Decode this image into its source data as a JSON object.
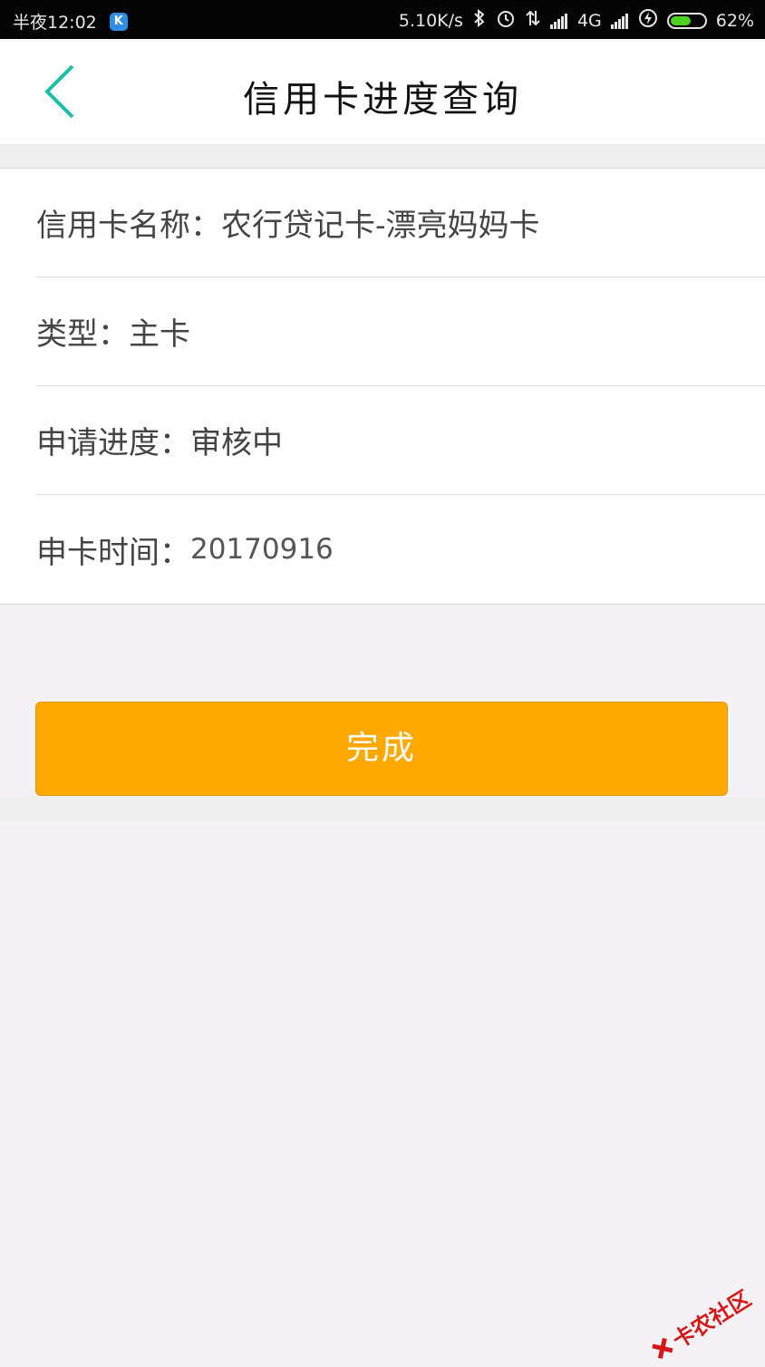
{
  "status_bar": {
    "time": "半夜12:02",
    "app_badge": "K",
    "net_speed": "5.10K/s",
    "network": "4G",
    "battery_level": 0.62,
    "battery_text": "62%"
  },
  "header": {
    "title": "信用卡进度查询"
  },
  "details": {
    "card_name_label": "信用卡名称：",
    "card_name_value": "农行贷记卡-漂亮妈妈卡",
    "type_label": "类型：",
    "type_value": "主卡",
    "progress_label": "申请进度：",
    "progress_value": "审核中",
    "apply_time_label": "申卡时间：",
    "apply_time_value": "20170916"
  },
  "actions": {
    "done_label": "完成"
  },
  "watermark": {
    "text": "卡农社区"
  },
  "colors": {
    "accent_teal": "#1bbfa8",
    "button_orange": "#ffa800",
    "battery_green": "#4cd21f"
  }
}
